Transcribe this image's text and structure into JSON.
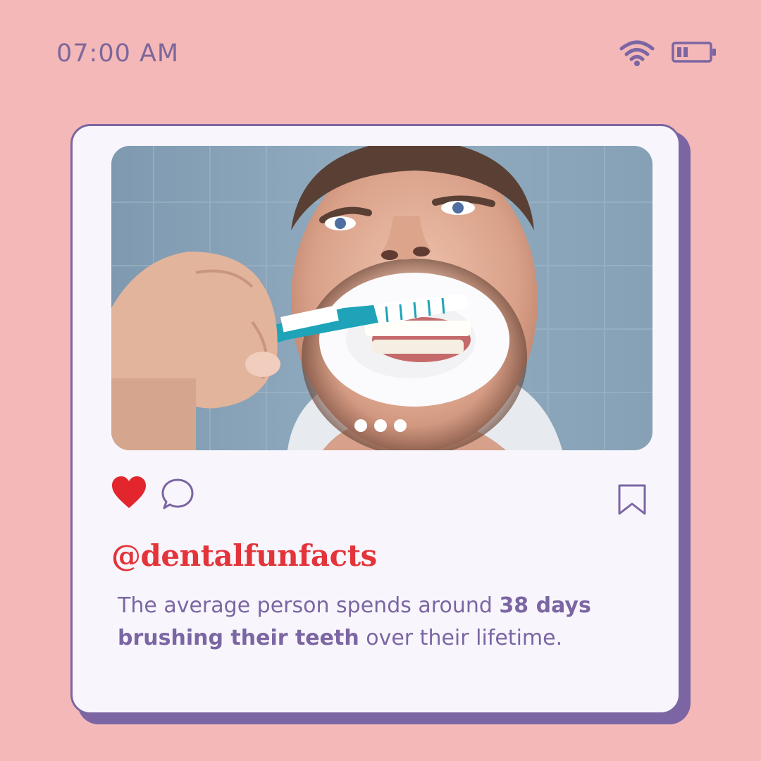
{
  "status_bar": {
    "time": "07:00 AM",
    "wifi_icon": "wifi-icon",
    "battery_icon": "battery-low-icon"
  },
  "post": {
    "image_description_icon": "photo",
    "carousel_count": 3,
    "carousel_active": 1,
    "actions": {
      "like_icon": "heart-icon",
      "liked": true,
      "comment_icon": "comment-icon",
      "save_icon": "bookmark-icon"
    },
    "handle": "@dentalfunfacts",
    "caption": {
      "part1": "The average person spends around ",
      "bold1": "38 days brushing their teeth",
      "part2": " over their lifetime."
    }
  },
  "colors": {
    "background": "#f4b8b8",
    "accent_purple": "#7b66a3",
    "handle_red": "#e3343a",
    "card": "#f8f6fc"
  }
}
